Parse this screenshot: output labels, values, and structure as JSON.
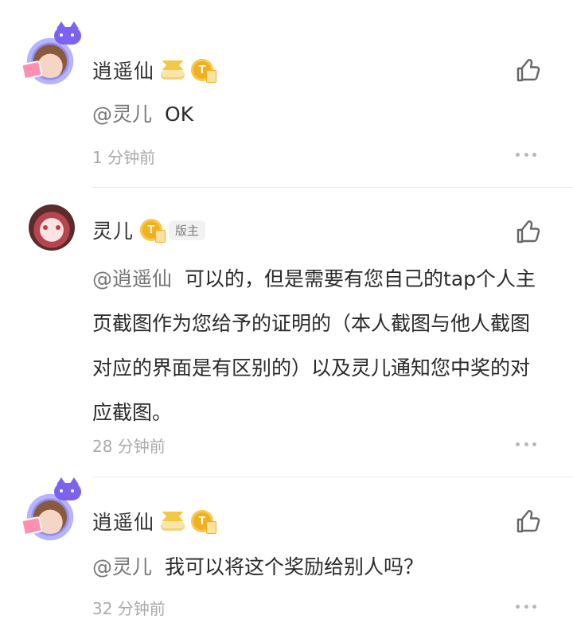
{
  "comments": [
    {
      "username": "逍遥仙",
      "mention": "@灵儿",
      "text": "OK",
      "time": "1 分钟前",
      "badge": "",
      "avatar": "frame-avatar",
      "icons": [
        "crown-icon",
        "coin-icon"
      ]
    },
    {
      "username": "灵儿",
      "mention": "@逍遥仙",
      "text": "可以的，但是需要有您自己的tap个人主页截图作为您给予的证明的（本人截图与他人截图对应的界面是有区别的）以及灵儿通知您中奖的对应截图。",
      "time": "28 分钟前",
      "badge": "版主",
      "avatar": "girl-avatar",
      "icons": [
        "coin-icon"
      ]
    },
    {
      "username": "逍遥仙",
      "mention": "@灵儿",
      "text": "我可以将这个奖励给别人吗？",
      "time": "32 分钟前",
      "badge": "",
      "avatar": "frame-avatar",
      "icons": [
        "crown-icon",
        "coin-icon"
      ]
    }
  ],
  "icons": {
    "like": "thumbs-up-icon",
    "more": "more-horizontal-icon"
  },
  "coin_letter": "T",
  "colors": {
    "text": "#2a2a2a",
    "muted": "#aaaaaa",
    "mention": "#777777",
    "coin": "#f2b01e"
  }
}
